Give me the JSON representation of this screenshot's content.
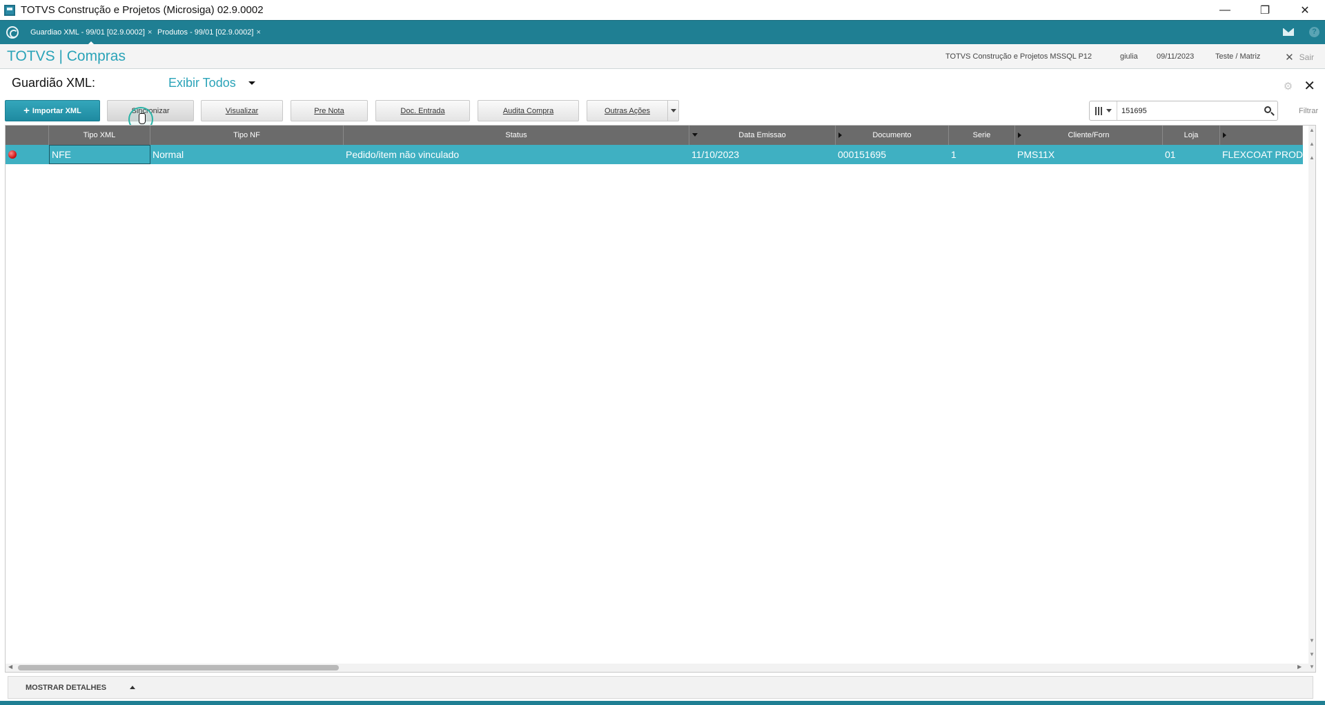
{
  "window": {
    "title": "TOTVS Construção e Projetos (Microsiga) 02.9.0002",
    "minimize_glyph": "—",
    "restore_glyph": "❐",
    "close_glyph": "✕"
  },
  "tabs": [
    {
      "label": "Guardiao XML - 99/01 [02.9.0002]",
      "close": "×"
    },
    {
      "label": "Produtos - 99/01 [02.9.0002]",
      "close": "×"
    }
  ],
  "header": {
    "module_title": "TOTVS | Compras",
    "company": "TOTVS Construção e Projetos MSSQL P12",
    "user": "giulia",
    "date": "09/11/2023",
    "branch": "Teste / Matriz",
    "exit_label": "Sair",
    "exit_glyph": "✕"
  },
  "routine": {
    "title": "Guardião XML:",
    "view_filter": "Exibir Todos",
    "close_glyph": "✕",
    "gear_glyph": "⚙"
  },
  "toolbar": {
    "import_plus": "+",
    "import_label": "Importar XML",
    "sync_label": "Sincronizar",
    "view_label": "Visualizar",
    "pre_note_label": "Pre Nota",
    "doc_entry_label": "Doc. Entrada",
    "audit_label": "Audita Compra",
    "other_actions_label": "Outras Ações"
  },
  "search": {
    "value": "151695",
    "filter_label": "Filtrar"
  },
  "grid": {
    "columns": [
      "Tipo XML",
      "Tipo NF",
      "Status",
      "Data Emissao",
      "Documento",
      "Serie",
      "Cliente/Forn",
      "Loja"
    ],
    "rows": [
      {
        "tipo_xml": "NFE",
        "tipo_nf": "Normal",
        "status": "Pedido/item não vinculado",
        "data_emissao": "11/10/2023",
        "documento": "000151695",
        "serie": "1",
        "cliente_forn": "PMS11X",
        "loja": "01",
        "nome": "FLEXCOAT PRODU"
      }
    ],
    "status_color": "#d01a1a",
    "row_color": "#3fb0c2"
  },
  "details": {
    "label": "MOSTRAR DETALHES"
  }
}
